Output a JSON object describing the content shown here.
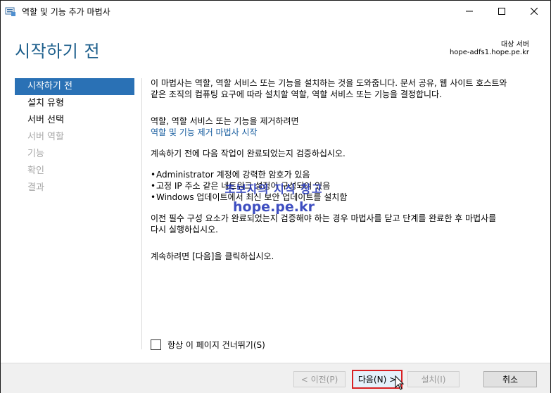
{
  "window": {
    "title": "역할 및 기능 추가 마법사"
  },
  "header": {
    "page_title": "시작하기 전",
    "dest_label": "대상 서버",
    "dest_server": "hope-adfs1.hope.pe.kr"
  },
  "nav": {
    "items": [
      {
        "label": "시작하기 전",
        "state": "active"
      },
      {
        "label": "설치 유형",
        "state": "normal"
      },
      {
        "label": "서버 선택",
        "state": "normal"
      },
      {
        "label": "서버 역할",
        "state": "disabled"
      },
      {
        "label": "기능",
        "state": "disabled"
      },
      {
        "label": "확인",
        "state": "disabled"
      },
      {
        "label": "결과",
        "state": "disabled"
      }
    ]
  },
  "content": {
    "intro_line1": "이 마법사는 역할, 역할 서비스 또는 기능을 설치하는 것을 도와줍니다. 문서 공유, 웹 사이트 호스트와",
    "intro_line2": "같은 조직의 컴퓨팅 요구에 따라 설치할 역할, 역할 서비스 또는 기능을 결정합니다.",
    "remove_intro": "역할, 역할 서비스 또는 기능을 제거하려면",
    "remove_link": "역할 및 기능 제거 마법사 시작",
    "verify_intro": "계속하기 전에 다음 작업이 완료되었는지 검증하십시오.",
    "bullets": [
      "Administrator 계정에 강력한 암호가 있음",
      "고정 IP 주소 같은 네트워크 설정이 구성되어 있음",
      "Windows 업데이트에서 최신 보안 업데이트를 설치함"
    ],
    "prereq_line1": "이전 필수 구성 요소가 완료되었는지 검증해야 하는 경우 마법사를 닫고 단계를 완료한 후 마법사를",
    "prereq_line2": "다시 실행하십시오.",
    "continue_text": "계속하려면 [다음]을 클릭하십시오."
  },
  "watermark": {
    "line1": "초보자의 지식 창고",
    "line2": "hope.pe.kr"
  },
  "skip": {
    "label": "항상 이 페이지 건너뛰기(S)",
    "checked": false
  },
  "footer": {
    "prev_label": "< 이전(P)",
    "next_label": "다음(N) >",
    "install_label": "설치(I)",
    "cancel_label": "취소"
  },
  "colors": {
    "accent": "#2a71b5",
    "title": "#1d5f8c",
    "link": "#1a5fa0",
    "highlight_border": "#d82124"
  }
}
